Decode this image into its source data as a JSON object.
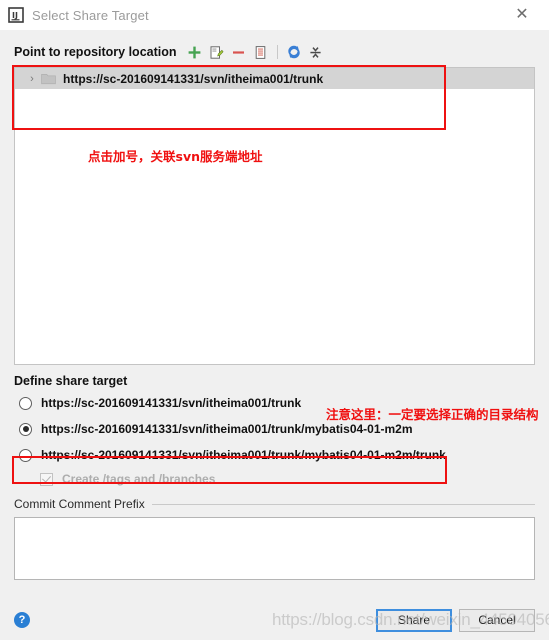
{
  "window": {
    "title": "Select Share Target",
    "app_icon": "intellij-idea-icon",
    "close_label": "✕"
  },
  "repository": {
    "section_label": "Point to repository location",
    "toolbar": [
      {
        "name": "add-icon",
        "glyph": "+",
        "tooltip": "Add"
      },
      {
        "name": "edit-icon",
        "glyph": "",
        "tooltip": "Edit"
      },
      {
        "name": "remove-icon",
        "glyph": "−",
        "tooltip": "Remove"
      },
      {
        "name": "details-icon",
        "glyph": "",
        "tooltip": "Details"
      },
      {
        "name": "refresh-icon",
        "glyph": "",
        "tooltip": "Refresh"
      },
      {
        "name": "collapse-all-icon",
        "glyph": "",
        "tooltip": "Collapse All"
      }
    ],
    "tree": [
      {
        "expander": "›",
        "icon": "folder-icon",
        "label": "https://sc-201609141331/svn/itheima001/trunk",
        "selected": true
      }
    ]
  },
  "annotations": {
    "plus_hint": "点击加号，关联svn服务端地址",
    "directory_hint": "注意这里：一定要选择正确的目录结构",
    "color": "#f01010",
    "box_color": "#ee1111"
  },
  "share_target": {
    "section_label": "Define share target",
    "options": [
      {
        "label": "https://sc-201609141331/svn/itheima001/trunk",
        "selected": false
      },
      {
        "label": "https://sc-201609141331/svn/itheima001/trunk/mybatis04-01-m2m",
        "selected": true
      },
      {
        "label": "https://sc-201609141331/svn/itheima001/trunk/mybatis04-01-m2m/trunk",
        "selected": false
      }
    ],
    "checkbox": {
      "label": "Create /tags and /branches",
      "checked": true,
      "disabled": true
    }
  },
  "commit_comment": {
    "group_label": "Commit Comment Prefix",
    "value": "",
    "placeholder": ""
  },
  "footer": {
    "help_glyph": "?",
    "share_label": "Share",
    "cancel_label": "Cancel"
  },
  "watermark": {
    "text": "https://blog.csdn.net/weixin_44504056"
  }
}
